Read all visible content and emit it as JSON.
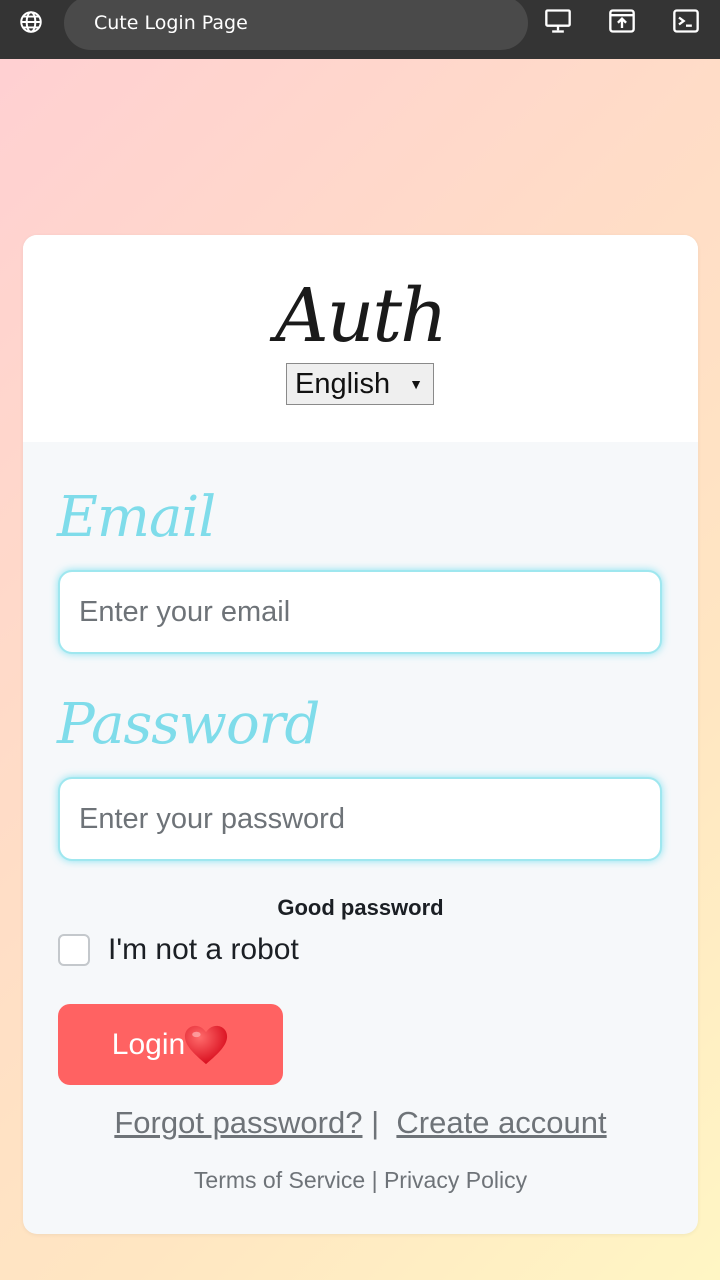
{
  "browser": {
    "tab_title": "Cute Login Page",
    "icons": [
      "globe-icon",
      "desktop-icon",
      "share-icon",
      "terminal-icon"
    ]
  },
  "auth": {
    "logo": "Auth",
    "language": "English",
    "email_label": "Email",
    "email_placeholder": "Enter your email",
    "password_label": "Password",
    "password_placeholder": "Enter your password",
    "password_strength": "Good password",
    "robot_label": "I'm not a robot",
    "login_label": "Login",
    "forgot_link": "Forgot password?",
    "link_separator": "|",
    "create_link": "Create account",
    "terms_link": "Terms of Service",
    "footer_separator": "|",
    "privacy_link": "Privacy Policy"
  },
  "colors": {
    "accent": "#7fdcea",
    "button": "#ff6262",
    "card": "#f6f8fa"
  }
}
